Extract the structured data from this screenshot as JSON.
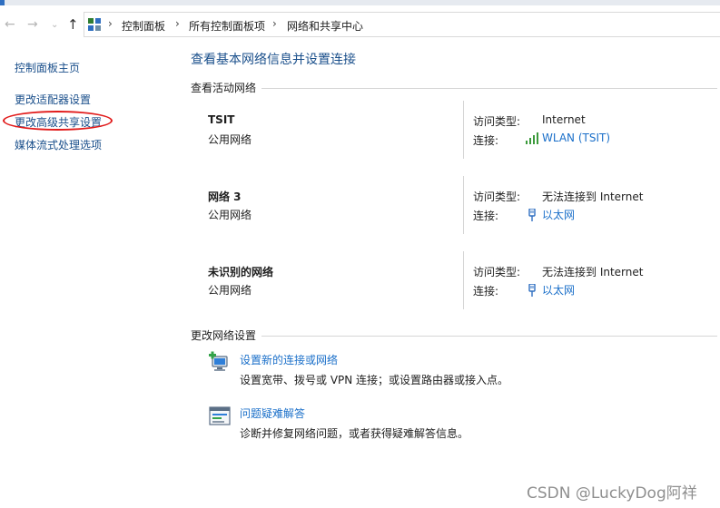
{
  "breadcrumb": [
    "控制面板",
    "所有控制面板项",
    "网络和共享中心"
  ],
  "left_nav": {
    "home": "控制面板主页",
    "links": [
      "更改适配器设置",
      "更改高级共享设置",
      "媒体流式处理选项"
    ]
  },
  "page_title": "查看基本网络信息并设置连接",
  "active_networks": {
    "heading": "查看活动网络",
    "access_label": "访问类型:",
    "conn_label": "连接:",
    "networks": [
      {
        "name": "TSIT",
        "type": "公用网络",
        "access": "Internet",
        "connection": "WLAN (TSIT)",
        "conn_icon": "wifi-signal-icon"
      },
      {
        "name": "网络 3",
        "type": "公用网络",
        "access": "无法连接到 Internet",
        "connection": "以太网",
        "conn_icon": "ethernet-icon"
      },
      {
        "name": "未识别的网络",
        "type": "公用网络",
        "access": "无法连接到 Internet",
        "connection": "以太网",
        "conn_icon": "ethernet-icon"
      }
    ]
  },
  "change_settings": {
    "heading": "更改网络设置",
    "tasks": [
      {
        "link": "设置新的连接或网络",
        "desc": "设置宽带、拨号或 VPN 连接；或设置路由器或接入点。",
        "icon": "new-connection-icon"
      },
      {
        "link": "问题疑难解答",
        "desc": "诊断并修复网络问题，或者获得疑难解答信息。",
        "icon": "troubleshoot-icon"
      }
    ]
  },
  "watermark": "CSDN @LuckyDog阿祥",
  "colors": {
    "link": "#1a6fc9",
    "nav_link": "#1a4f8b",
    "annotation": "#e11b1b"
  }
}
